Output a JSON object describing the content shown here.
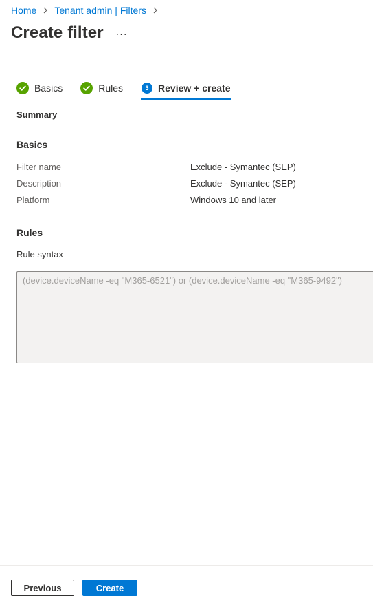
{
  "breadcrumb": {
    "items": [
      "Home",
      "Tenant admin | Filters"
    ]
  },
  "page": {
    "title": "Create filter",
    "more_label": "···"
  },
  "wizard": {
    "steps": [
      {
        "label": "Basics",
        "status": "complete"
      },
      {
        "label": "Rules",
        "status": "complete"
      },
      {
        "label": "Review + create",
        "number": "3",
        "status": "active"
      }
    ]
  },
  "summary": {
    "heading": "Summary",
    "basics": {
      "heading": "Basics",
      "rows": [
        {
          "key": "Filter name",
          "value": "Exclude - Symantec (SEP)"
        },
        {
          "key": "Description",
          "value": "Exclude - Symantec (SEP)"
        },
        {
          "key": "Platform",
          "value": "Windows 10 and later"
        }
      ]
    },
    "rules": {
      "heading": "Rules",
      "syntax_label": "Rule syntax",
      "syntax_value": "(device.deviceName -eq \"M365-6521\") or (device.deviceName -eq \"M365-9492\")"
    }
  },
  "footer": {
    "previous_label": "Previous",
    "create_label": "Create"
  },
  "colors": {
    "accent": "#0078d4",
    "success": "#57a300",
    "text": "#323130"
  }
}
